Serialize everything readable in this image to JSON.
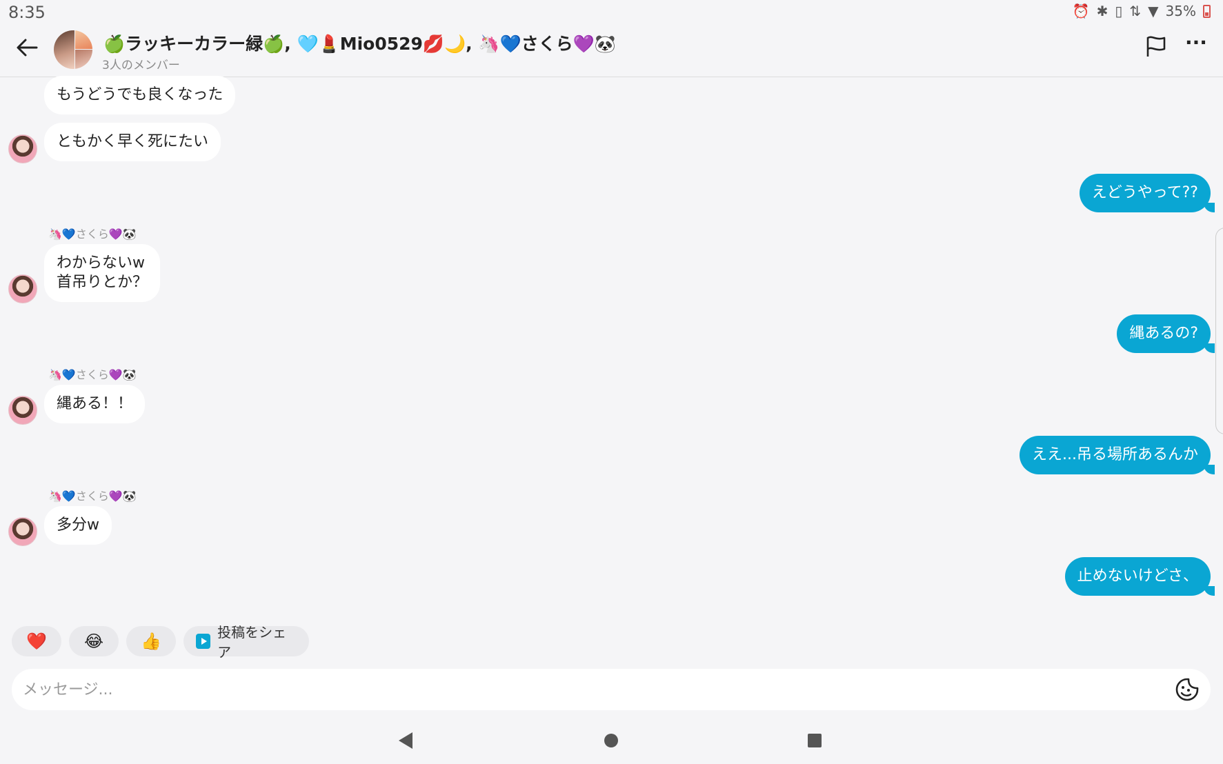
{
  "status_bar": {
    "time": "8:35",
    "battery": "35%",
    "icons": [
      "alarm-icon",
      "bluetooth-icon",
      "vibrate-icon",
      "data-icon",
      "wifi-icon",
      "battery-icon"
    ]
  },
  "header": {
    "title": "🍏ラッキーカラー緑🍏, 🩵💄Mio0529💋🌙, 🦄💙さくら💜🐼",
    "subtitle": "3人のメンバー"
  },
  "messages": [
    {
      "side": "in",
      "text": "もうどうでも良くなった",
      "sender": "",
      "avatar": false
    },
    {
      "side": "in",
      "text": "ともかく早く死にたい",
      "sender": "",
      "avatar": true
    },
    {
      "side": "out",
      "text": "えどうやって??"
    },
    {
      "side": "in",
      "text_line1": "わからないw",
      "text_line2": "首吊りとか？",
      "sender": "🦄💙さくら💜🐼",
      "avatar": true
    },
    {
      "side": "out",
      "text": "縄あるの?"
    },
    {
      "side": "in",
      "text": "縄ある！！",
      "sender": "🦄💙さくら💜🐼",
      "avatar": true
    },
    {
      "side": "out",
      "text": "ええ...吊る場所あるんか"
    },
    {
      "side": "in",
      "text": "多分w",
      "sender": "🦄💙さくら💜🐼",
      "avatar": true
    },
    {
      "side": "out",
      "text": "止めないけどさ、"
    }
  ],
  "quick_reactions": [
    "❤️",
    "😂",
    "👍"
  ],
  "share_post_label": "投稿をシェア",
  "composer": {
    "placeholder": "メッセージ..."
  }
}
